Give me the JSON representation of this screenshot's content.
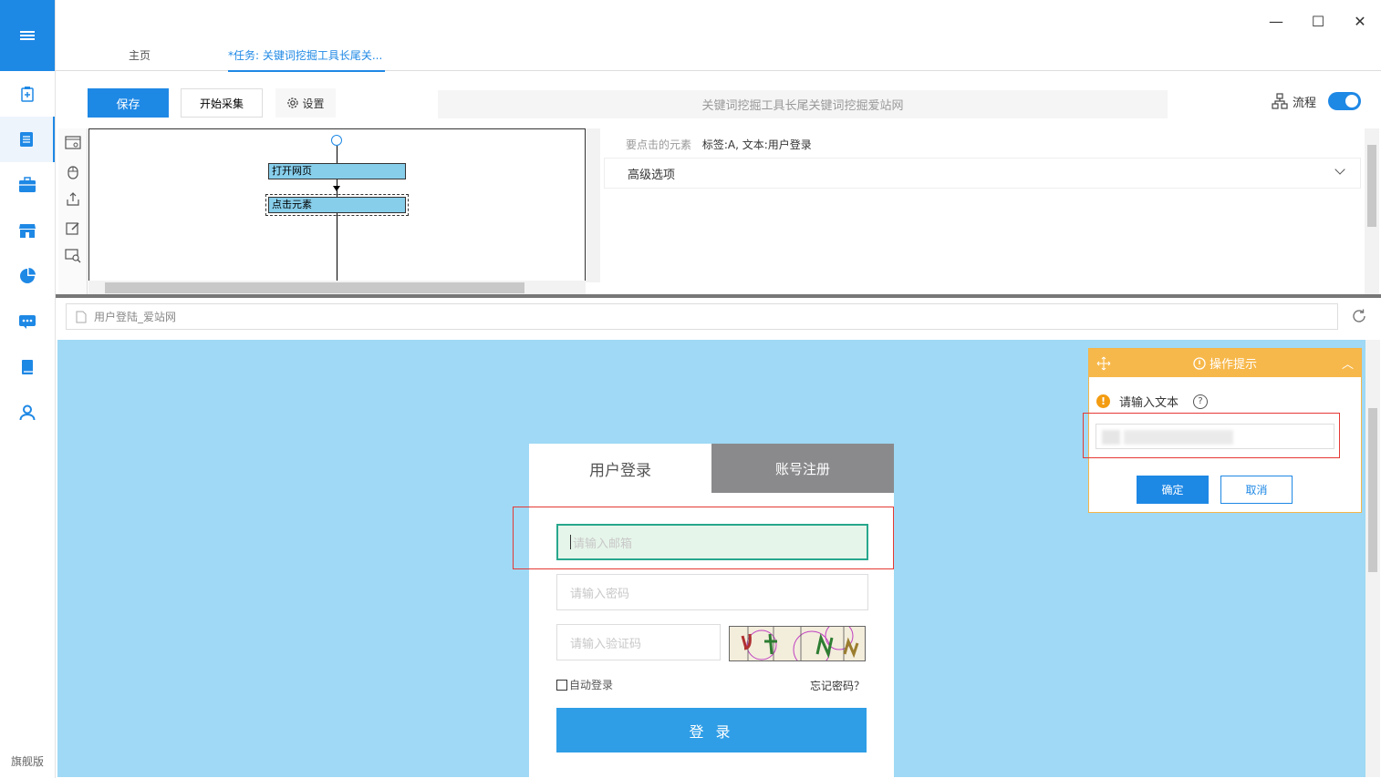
{
  "rail": {
    "footer_label": "旗舰版",
    "accent_color": "#1e88e5"
  },
  "window": {
    "minimize": "—",
    "maximize": "☐",
    "close": "✕"
  },
  "tabs": {
    "home": "主页",
    "task": "*任务: 关键词挖掘工具长尾关..."
  },
  "toolbar": {
    "save": "保存",
    "start": "开始采集",
    "settings": "设置",
    "url_title": "关键词挖掘工具长尾关键词挖掘爱站网",
    "flow_label": "流程",
    "flow_toggle_on": true
  },
  "workflow": {
    "nodes": [
      "打开网页",
      "点击元素"
    ]
  },
  "properties": {
    "element_label": "要点击的元素",
    "element_value": "标签:A, 文本:用户登录",
    "advanced": "高级选项"
  },
  "address": {
    "page_title": "用户登陆_爱站网"
  },
  "webpage": {
    "background": "#9fd9f5",
    "tab_login": "用户登录",
    "tab_register": "账号注册",
    "email_placeholder": "请输入邮箱",
    "password_placeholder": "请输入密码",
    "code_placeholder": "请输入验证码",
    "remember": "自动登录",
    "forgot": "忘记密码？",
    "login_button": "登 录"
  },
  "tip": {
    "title": "操作提示",
    "message": "请输入文本",
    "ok": "确定",
    "cancel": "取消"
  }
}
